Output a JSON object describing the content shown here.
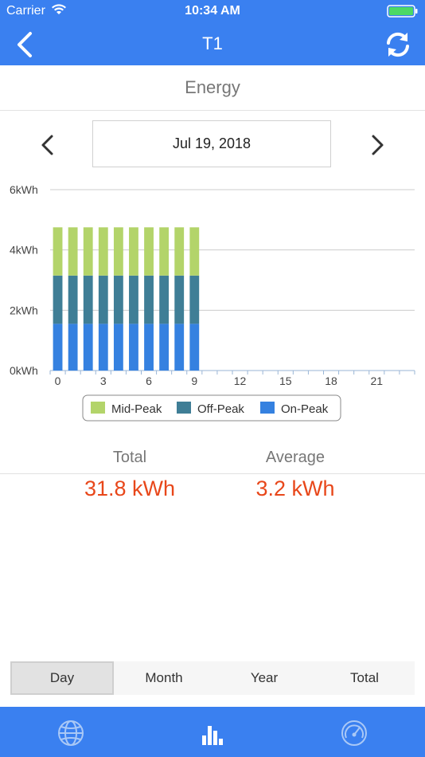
{
  "status_bar": {
    "carrier": "Carrier",
    "time": "10:34 AM"
  },
  "nav": {
    "title": "T1"
  },
  "section": {
    "title": "Energy"
  },
  "date_picker": {
    "date": "Jul 19, 2018"
  },
  "chart_data": {
    "type": "bar",
    "stacked": true,
    "x": [
      0,
      1,
      2,
      3,
      4,
      5,
      6,
      7,
      8,
      9,
      10,
      11,
      12,
      13,
      14,
      15,
      16,
      17,
      18,
      19,
      20,
      21,
      22,
      23
    ],
    "xticks": [
      "0",
      "3",
      "6",
      "9",
      "12",
      "15",
      "18",
      "21"
    ],
    "xtick_values": [
      0,
      3,
      6,
      9,
      12,
      15,
      18,
      21
    ],
    "yticks": [
      "0kWh",
      "2kWh",
      "4kWh",
      "6kWh"
    ],
    "ytick_values": [
      0,
      2,
      4,
      6
    ],
    "ylim": [
      0,
      6
    ],
    "grid": true,
    "legend_position": "bottom",
    "series": [
      {
        "name": "On-Peak",
        "color": "#3581e0",
        "values": [
          1.55,
          1.55,
          1.55,
          1.55,
          1.55,
          1.55,
          1.55,
          1.55,
          1.55,
          1.55
        ]
      },
      {
        "name": "Off-Peak",
        "color": "#3f7e96",
        "values": [
          1.6,
          1.6,
          1.6,
          1.6,
          1.6,
          1.6,
          1.6,
          1.6,
          1.6,
          1.6
        ]
      },
      {
        "name": "Mid-Peak",
        "color": "#b3d46a",
        "values": [
          1.6,
          1.6,
          1.6,
          1.6,
          1.6,
          1.6,
          1.6,
          1.6,
          1.6,
          1.6
        ]
      }
    ],
    "legend": [
      "Mid-Peak",
      "Off-Peak",
      "On-Peak"
    ]
  },
  "stats": {
    "total_label": "Total",
    "total_value": "31.8 kWh",
    "average_label": "Average",
    "average_value": "3.2 kWh"
  },
  "segments": [
    "Day",
    "Month",
    "Year",
    "Total"
  ],
  "segment_active": "Day",
  "colors": {
    "brand": "#3a80f0",
    "accent_value": "#e8471a"
  },
  "icons": {
    "back": "chevron-left-icon",
    "refresh": "refresh-icon",
    "prev": "chevron-left-icon",
    "next": "chevron-right-icon",
    "tab1": "globe-icon",
    "tab2": "bar-chart-icon",
    "tab3": "gauge-icon"
  }
}
